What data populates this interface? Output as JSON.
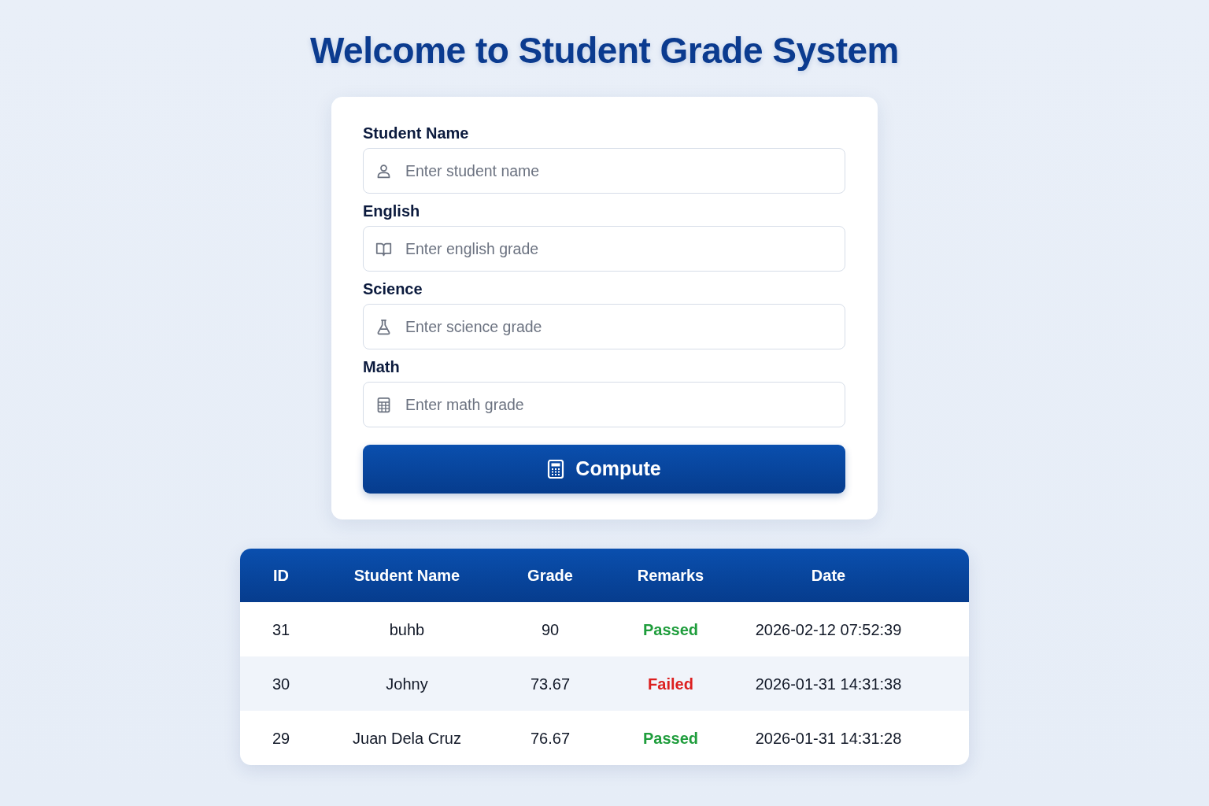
{
  "title": "Welcome to Student Grade System",
  "form": {
    "fields": [
      {
        "label": "Student Name",
        "placeholder": "Enter student name"
      },
      {
        "label": "English",
        "placeholder": "Enter english grade"
      },
      {
        "label": "Science",
        "placeholder": "Enter science grade"
      },
      {
        "label": "Math",
        "placeholder": "Enter math grade"
      }
    ],
    "button": "Compute"
  },
  "table": {
    "columns": [
      "ID",
      "Student Name",
      "Grade",
      "Remarks",
      "Date"
    ],
    "rows": [
      {
        "id": "31",
        "student_name": "buhb",
        "grade": "90",
        "remarks": {
          "text": "Passed",
          "color": "#1f9d3c"
        },
        "date": "2026-02-12 07:52:39"
      },
      {
        "id": "30",
        "student_name": "Johny",
        "grade": "73.67",
        "remarks": {
          "text": "Failed",
          "color": "#dc1f1f"
        },
        "date": "2026-01-31 14:31:38"
      },
      {
        "id": "29",
        "student_name": "Juan Dela Cruz",
        "grade": "76.67",
        "remarks": {
          "text": "Passed",
          "color": "#1f9d3c"
        },
        "date": "2026-01-31 14:31:28"
      }
    ]
  }
}
